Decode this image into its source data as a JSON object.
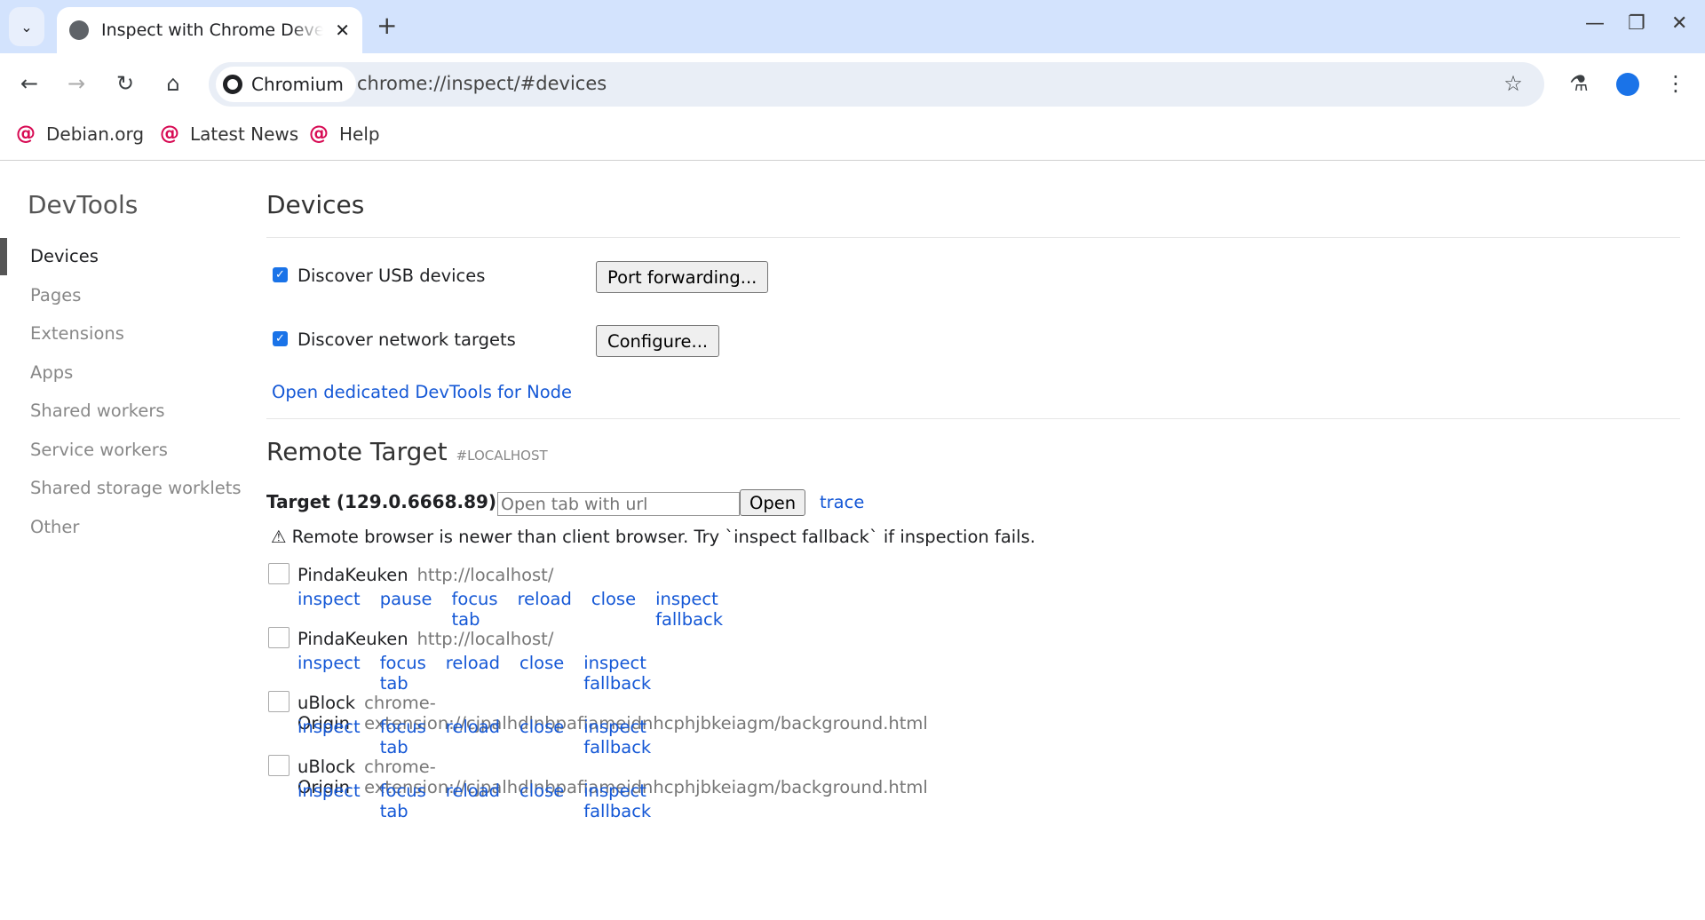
{
  "browser": {
    "tab_title": "Inspect with Chrome Developer Tools",
    "chip_label": "Chromium",
    "url": "chrome://inspect/#devices",
    "bookmarks": [
      "Debian.org",
      "Latest News",
      "Help"
    ]
  },
  "sidebar": {
    "title": "DevTools",
    "items": [
      "Devices",
      "Pages",
      "Extensions",
      "Apps",
      "Shared workers",
      "Service workers",
      "Shared storage worklets",
      "Other"
    ],
    "active": "Devices"
  },
  "devices": {
    "title": "Devices",
    "usb_label": "Discover USB devices",
    "usb_checked": true,
    "port_forwarding": "Port forwarding...",
    "network_label": "Discover network targets",
    "network_checked": true,
    "configure": "Configure...",
    "node_link": "Open dedicated DevTools for Node"
  },
  "remote": {
    "title": "Remote Target",
    "subtitle": "#LOCALHOST",
    "target": "Target (129.0.6668.89)",
    "url_placeholder": "Open tab with url",
    "open": "Open",
    "trace": "trace",
    "warning": "⚠ Remote browser is newer than client browser. Try `inspect fallback` if inspection fails.",
    "entries": [
      {
        "name": "PindaKeuken",
        "url": "http://localhost/",
        "actions": [
          "inspect",
          "pause",
          "focus tab",
          "reload",
          "close",
          "inspect fallback"
        ]
      },
      {
        "name": "PindaKeuken",
        "url": "http://localhost/",
        "actions": [
          "inspect",
          "focus tab",
          "reload",
          "close",
          "inspect fallback"
        ]
      },
      {
        "name": "uBlock Origin",
        "url": "chrome-extension://cjpalhdlnbpafiamejdnhcphjbkeiagm/background.html",
        "actions": [
          "inspect",
          "focus tab",
          "reload",
          "close",
          "inspect fallback"
        ]
      },
      {
        "name": "uBlock Origin",
        "url": "chrome-extension://cjpalhdlnbpafiamejdnhcphjbkeiagm/background.html",
        "actions": [
          "inspect",
          "focus tab",
          "reload",
          "close",
          "inspect fallback"
        ]
      }
    ]
  }
}
